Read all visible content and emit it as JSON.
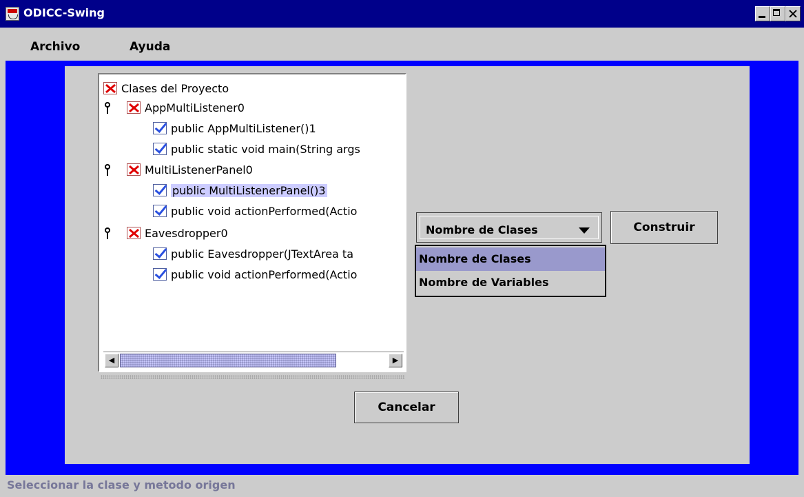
{
  "window": {
    "title": "ODICC-Swing"
  },
  "menu": {
    "items": [
      "Archivo",
      "Ayuda"
    ]
  },
  "tree": {
    "root": "Clases del Proyecto",
    "rows": [
      {
        "text": "AppMultiListener0",
        "kind": "class"
      },
      {
        "text": "public AppMultiListener()1",
        "kind": "method"
      },
      {
        "text": "public static void main(String args",
        "kind": "method"
      },
      {
        "text": "MultiListenerPanel0",
        "kind": "class"
      },
      {
        "text": "public MultiListenerPanel()3",
        "kind": "method",
        "selected": true
      },
      {
        "text": "public void actionPerformed(Actio",
        "kind": "method"
      },
      {
        "text": "Eavesdropper0",
        "kind": "class"
      },
      {
        "text": "public Eavesdropper(JTextArea ta",
        "kind": "method"
      },
      {
        "text": "public void actionPerformed(Actio",
        "kind": "method"
      }
    ],
    "scroll_left_icon": "◀",
    "scroll_right_icon": "▶"
  },
  "combo": {
    "value": "Nombre de Clases",
    "options": [
      "Nombre de Clases",
      "Nombre de Variables"
    ]
  },
  "buttons": {
    "construir": "Construir",
    "cancelar": "Cancelar"
  },
  "status": "Seleccionar la clase y metodo origen",
  "colors": {
    "titlebar": "#00008a",
    "background_blue": "#0000ff",
    "panel": "#cccccc",
    "selection": "#9999cc"
  }
}
